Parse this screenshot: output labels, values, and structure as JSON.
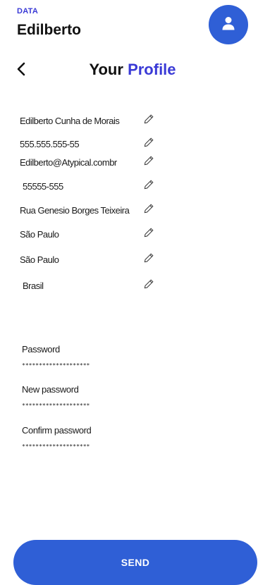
{
  "header": {
    "app_label": "DATA",
    "user_name": "Edilberto",
    "avatar_icon": "user-icon"
  },
  "nav": {
    "back_icon": "chevron-left-icon",
    "title_main": "Your",
    "title_accent": "Profile"
  },
  "profile_fields": [
    {
      "value": "Edilberto Cunha de Morais",
      "edit_icon": "pencil-icon"
    },
    {
      "value": "555.555.555-55",
      "edit_icon": "pencil-icon"
    },
    {
      "value": "Edilberto@Atypical.combr",
      "edit_icon": "pencil-icon"
    },
    {
      "value": "55555-555",
      "edit_icon": "pencil-icon"
    },
    {
      "value": "Rua Genesio Borges Teixeira",
      "edit_icon": "pencil-icon"
    },
    {
      "value": "São Paulo",
      "edit_icon": "pencil-icon"
    },
    {
      "value": "São Paulo",
      "edit_icon": "pencil-icon"
    },
    {
      "value": "Brasil",
      "edit_icon": "pencil-icon"
    }
  ],
  "password_section": {
    "password_label": "Password",
    "password_value": "********************",
    "new_password_label": "New password",
    "new_password_value": "********************",
    "confirm_password_label": "Confirm password",
    "confirm_password_value": "********************"
  },
  "actions": {
    "send_label": "SEND"
  },
  "colors": {
    "accent": "#3a3ad6",
    "primary_button": "#2f5fd6",
    "text": "#111111",
    "background": "#ffffff"
  }
}
